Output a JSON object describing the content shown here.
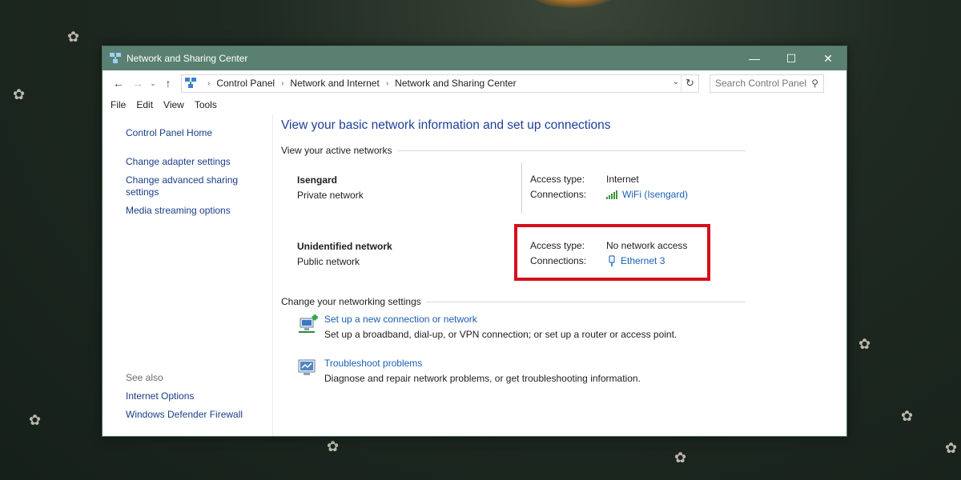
{
  "window": {
    "title": "Network and Sharing Center",
    "controls": {
      "minimize": "—",
      "maximize": "☐",
      "close": "✕"
    }
  },
  "nav": {
    "back": "←",
    "forward": "→",
    "recent": "⌄",
    "up": "↑",
    "breadcrumb": [
      "Control Panel",
      "Network and Internet",
      "Network and Sharing Center"
    ],
    "search_placeholder": "Search Control Panel"
  },
  "menu": [
    "File",
    "Edit",
    "View",
    "Tools"
  ],
  "sidebar": {
    "home": "Control Panel Home",
    "items": [
      "Change adapter settings",
      "Change advanced sharing settings",
      "Media streaming options"
    ],
    "see_also_label": "See also",
    "see_also": [
      "Internet Options",
      "Windows Defender Firewall"
    ]
  },
  "main": {
    "heading": "View your basic network information and set up connections",
    "active_networks_label": "View your active networks",
    "networks": [
      {
        "name": "Isengard",
        "category": "Private network",
        "access_label": "Access type:",
        "access": "Internet",
        "connections_label": "Connections:",
        "connection": "WiFi (Isengard)",
        "icon": "wifi-signal-icon"
      },
      {
        "name": "Unidentified network",
        "category": "Public network",
        "access_label": "Access type:",
        "access": "No network access",
        "connections_label": "Connections:",
        "connection": "Ethernet 3",
        "icon": "ethernet-icon"
      }
    ],
    "change_settings_label": "Change your networking settings",
    "tasks": [
      {
        "title": "Set up a new connection or network",
        "desc": "Set up a broadband, dial-up, or VPN connection; or set up a router or access point.",
        "icon": "new-connection-icon"
      },
      {
        "title": "Troubleshoot problems",
        "desc": "Diagnose and repair network problems, or get troubleshooting information.",
        "icon": "troubleshoot-icon"
      }
    ]
  },
  "colors": {
    "titlebar": "#5a8071",
    "link": "#1a5fb4",
    "heading": "#1e3f9a",
    "highlight": "#d5101e"
  }
}
